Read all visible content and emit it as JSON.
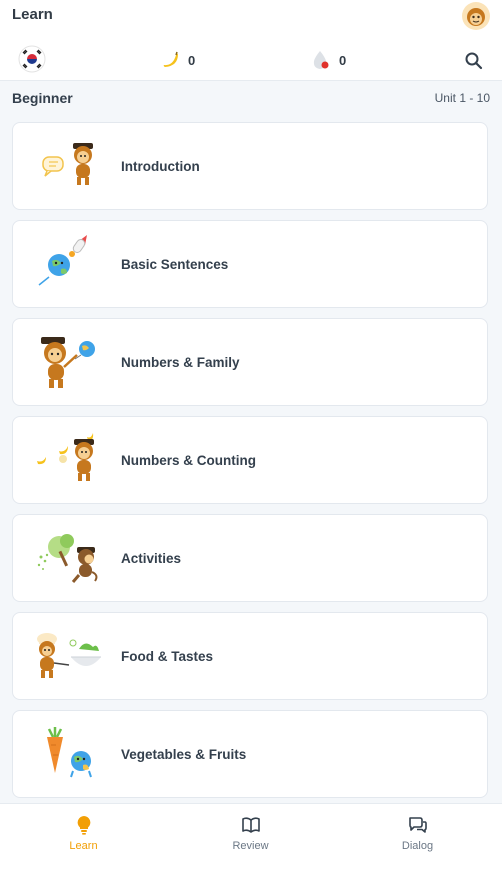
{
  "header": {
    "title": "Learn",
    "avatar_icon": "monkey-avatar-icon",
    "language_flag_icon": "korea-flag-icon",
    "stats": {
      "bananas": {
        "icon": "banana-icon",
        "value": "0"
      },
      "streak": {
        "icon": "streak-icon",
        "value": "0"
      }
    },
    "search_icon": "search-icon"
  },
  "section": {
    "level": "Beginner",
    "unit_range": "Unit 1 - 10"
  },
  "lessons": [
    {
      "title": "Introduction",
      "icon": "monkey-speech-bubble-icon"
    },
    {
      "title": "Basic Sentences",
      "icon": "globe-rocket-icon"
    },
    {
      "title": "Numbers & Family",
      "icon": "monkey-globe-balloon-icon"
    },
    {
      "title": "Numbers & Counting",
      "icon": "monkey-bananas-icon"
    },
    {
      "title": "Activities",
      "icon": "monkey-tree-icon"
    },
    {
      "title": "Food & Tastes",
      "icon": "chef-monkey-bowl-icon"
    },
    {
      "title": "Vegetables & Fruits",
      "icon": "carrot-globe-icon"
    }
  ],
  "bottom_nav": [
    {
      "label": "Learn",
      "icon": "lightbulb-icon",
      "active": true
    },
    {
      "label": "Review",
      "icon": "book-icon",
      "active": false
    },
    {
      "label": "Dialog",
      "icon": "chat-bubbles-icon",
      "active": false
    }
  ],
  "colors": {
    "accent": "#f29f05",
    "text": "#34404d",
    "background": "#f4f7fa",
    "card": "#ffffff"
  }
}
